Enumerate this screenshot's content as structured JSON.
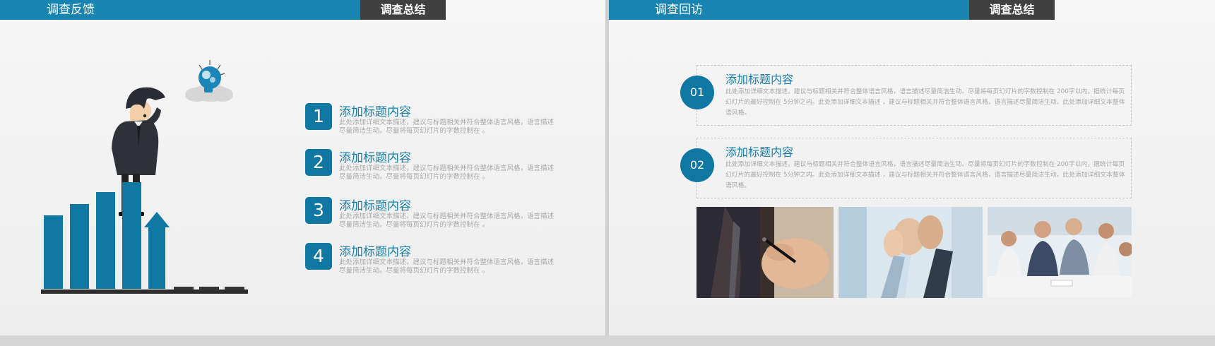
{
  "left_slide": {
    "title": "调查反馈",
    "tag": "调查总结",
    "items": [
      {
        "num": "1",
        "title": "添加标题内容",
        "desc": "此处添加详细文本描述，建议与标题相关并符合整体语言风格，语言描述尽量简洁生动。尽量将每页幻灯片的字数控制在 。"
      },
      {
        "num": "2",
        "title": "添加标题内容",
        "desc": "此处添加详细文本描述，建议与标题相关并符合整体语言风格，语言描述尽量简洁生动。尽量将每页幻灯片的字数控制在 。"
      },
      {
        "num": "3",
        "title": "添加标题内容",
        "desc": "此处添加详细文本描述，建议与标题相关并符合整体语言风格，语言描述尽量简洁生动。尽量将每页幻灯片的字数控制在 。"
      },
      {
        "num": "4",
        "title": "添加标题内容",
        "desc": "此处添加详细文本描述，建议与标题相关并符合整体语言风格，语言描述尽量简洁生动。尽量将每页幻灯片的字数控制在 。"
      }
    ]
  },
  "right_slide": {
    "title": "调查回访",
    "tag": "调查总结",
    "cards": [
      {
        "num": "01",
        "title": "添加标题内容",
        "desc": "此处添加详细文本描述，建议与标题相关并符合整体语言风格，语言描述尽量简洁生动。尽量将每页幻灯片的字数控制在 200字以内，据统计每页幻灯片的最好控制在 5分钟之内。此处添加详细文本描述 ，建议与标题相关并符合整体语言风格，语言描述尽量简洁生动。此处添加详细文本整体语风格。"
      },
      {
        "num": "02",
        "title": "添加标题内容",
        "desc": "此处添加详细文本描述，建议与标题相关并符合整体语言风格，语言描述尽量简洁生动。尽量将每页幻灯片的字数控制在 200字以内，据统计每页幻灯片的最好控制在 5分钟之内。此处添加详细文本描述 ，建议与标题相关并符合整体语言风格，语言描述尽量简洁生动。此处添加详细文本整体语风格。"
      }
    ]
  },
  "colors": {
    "accent": "#1784b2",
    "dark_tag": "#404040",
    "bar": "#0f78a2"
  }
}
